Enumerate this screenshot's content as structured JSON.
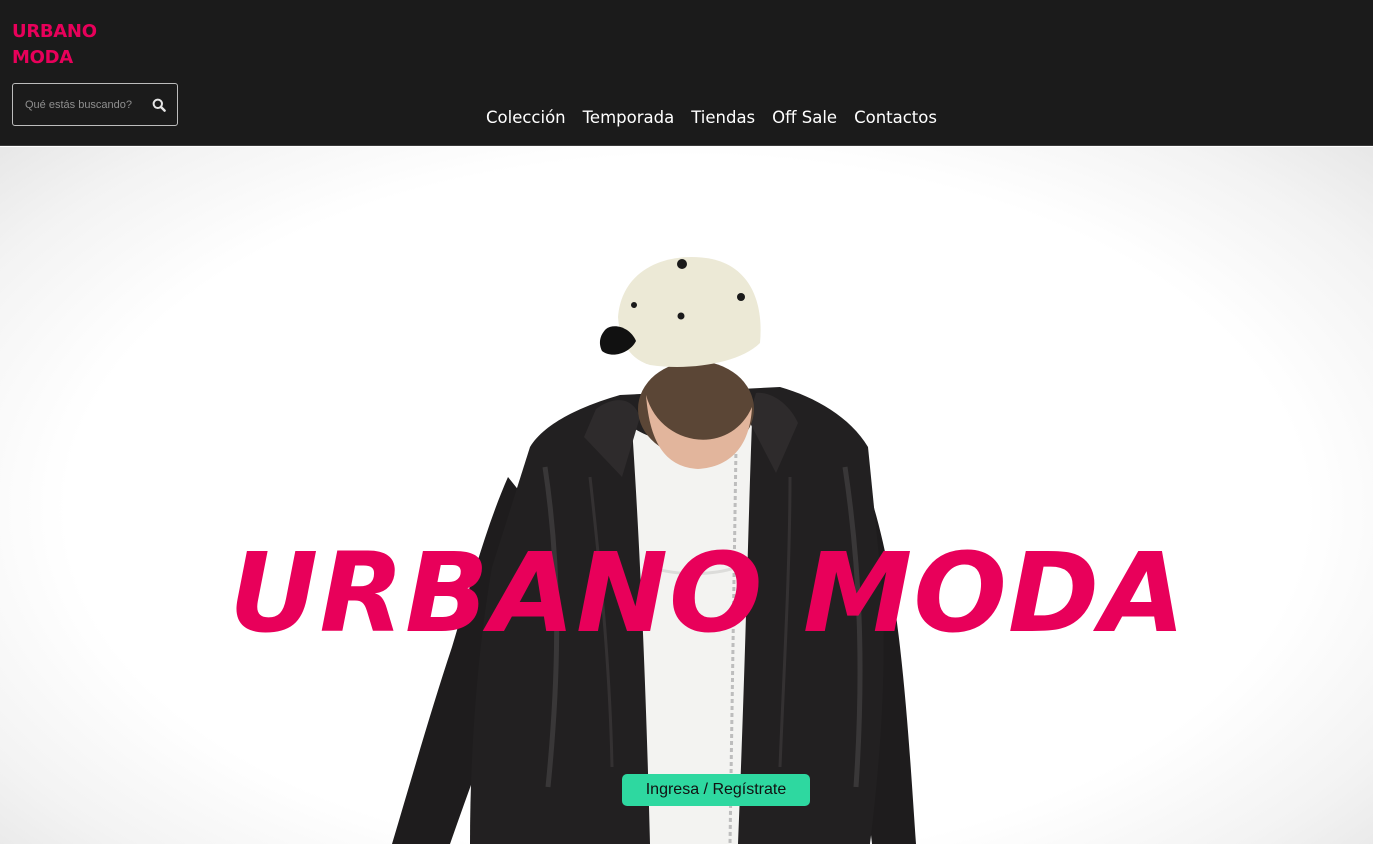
{
  "header": {
    "logo": {
      "line1": "URBANO",
      "line2": "MODA"
    },
    "search": {
      "placeholder": "Qué estás buscando?",
      "icon": "search-icon"
    },
    "nav": [
      {
        "label": "Colección"
      },
      {
        "label": "Temporada"
      },
      {
        "label": "Tiendas"
      },
      {
        "label": "Off Sale"
      },
      {
        "label": "Contactos"
      }
    ]
  },
  "hero": {
    "title": "URBANO MODA",
    "cta_label": "Ingresa / Regístrate",
    "image": "man-in-leather-jacket-and-cap"
  },
  "colors": {
    "brand_pink": "#e8005a",
    "header_bg": "#1b1b1b",
    "cta_green": "#2ed8a0"
  }
}
